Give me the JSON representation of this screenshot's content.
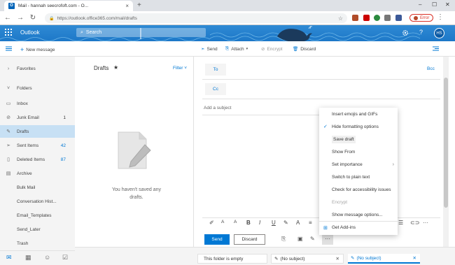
{
  "browser": {
    "tab_title": "Mail - hannah seecrofoft.com - O...",
    "url": "https://outlook.office365.com/mail/drafts",
    "error_label": "Error"
  },
  "app": {
    "name": "Outlook",
    "search_placeholder": "Search",
    "avatar_initials": "HS"
  },
  "toolbar": {
    "new_message": "New message",
    "send": "Send",
    "attach": "Attach",
    "encrypt": "Encrypt",
    "discard": "Discard"
  },
  "nav": {
    "favorites": "Favorites",
    "folders": "Folders",
    "items": [
      {
        "label": "Inbox",
        "count": ""
      },
      {
        "label": "Junk Email",
        "count": "1"
      },
      {
        "label": "Drafts",
        "count": ""
      },
      {
        "label": "Sent Items",
        "count": "42"
      },
      {
        "label": "Deleted Items",
        "count": "87"
      },
      {
        "label": "Archive",
        "count": ""
      },
      {
        "label": "Bulk Mail",
        "count": ""
      },
      {
        "label": "Conversation Hist...",
        "count": ""
      },
      {
        "label": "Email_Templates",
        "count": ""
      },
      {
        "label": "Send_Later",
        "count": ""
      },
      {
        "label": "Trash",
        "count": ""
      }
    ]
  },
  "list": {
    "folder_title": "Drafts",
    "filter": "Filter",
    "empty_line1": "You haven't saved any",
    "empty_line2": "drafts."
  },
  "compose": {
    "to": "To",
    "cc": "Cc",
    "bcc": "Bcc",
    "subject_placeholder": "Add a subject",
    "send": "Send",
    "discard": "Discard"
  },
  "menu": {
    "items": [
      {
        "label": "Insert emojis and GIFs",
        "checked": false,
        "disabled": false,
        "submenu": false
      },
      {
        "label": "Hide formatting options",
        "checked": true,
        "disabled": false,
        "submenu": false
      },
      {
        "label": "Save draft",
        "checked": false,
        "disabled": false,
        "submenu": false
      },
      {
        "label": "Show From",
        "checked": false,
        "disabled": false,
        "submenu": false
      },
      {
        "label": "Set importance",
        "checked": false,
        "disabled": false,
        "submenu": true
      },
      {
        "label": "Switch to plain text",
        "checked": false,
        "disabled": false,
        "submenu": false
      },
      {
        "label": "Check for accessibility issues",
        "checked": false,
        "disabled": false,
        "submenu": false
      },
      {
        "label": "Encrypt",
        "checked": false,
        "disabled": true,
        "submenu": false
      },
      {
        "label": "Show message options...",
        "checked": false,
        "disabled": false,
        "submenu": false
      },
      {
        "label": "Get Add-ins",
        "checked": false,
        "disabled": false,
        "submenu": false
      }
    ]
  },
  "bottom_tabs": {
    "empty": "This folder is empty",
    "draft1": "(No subject)",
    "draft2": "(No subject)"
  },
  "colors": {
    "accent": "#0078d4",
    "header": "#1d78c8",
    "selected_nav": "#c7e0f4"
  }
}
